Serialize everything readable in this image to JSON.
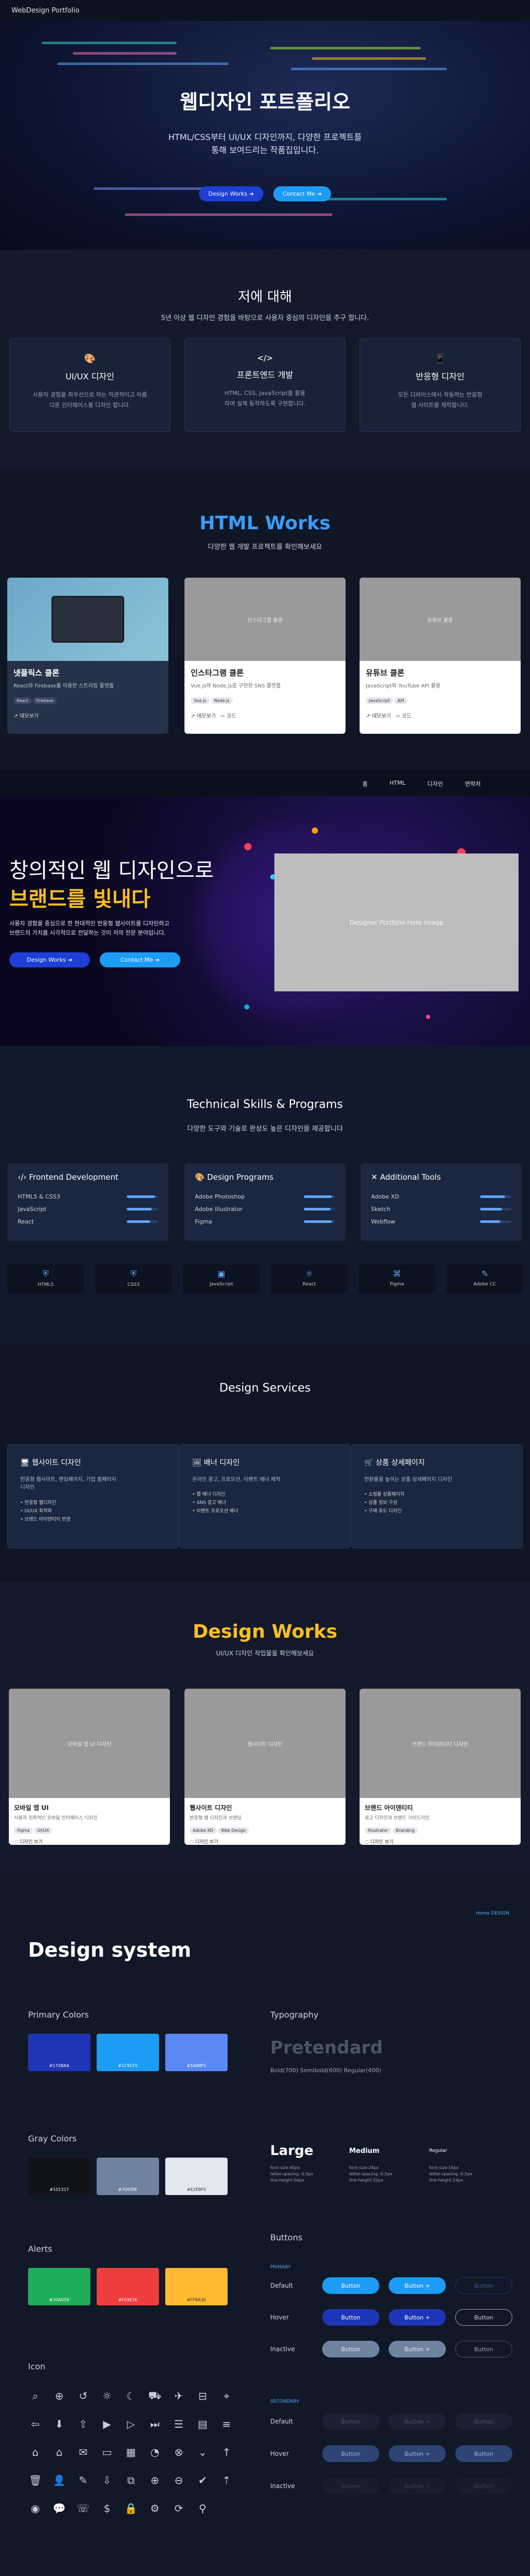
{
  "header": {
    "title": "WebDesign Portfolio"
  },
  "hero": {
    "title": "웹디자인 포트폴리오",
    "subtitle1": "HTML/CSS부터 UI/UX 디자인까지, 다양한 프로젝트를",
    "subtitle2": "통해 보여드리는 작품집입니다.",
    "btn1": "Design Works ➜",
    "btn2": "Contact Me ➜"
  },
  "about": {
    "title": "저에 대해",
    "desc": "5년 이상 웹 디자인 경험을 바탕으로 사용자 중심의 디자인을 추구 합니다.",
    "cards": [
      {
        "icon": "palette",
        "title": "UI/UX 디자인",
        "d1": "사용자 경험을 최우선으로 하는 직관적이고 아름",
        "d2": "다운 인터페이스를 디자인 합니다."
      },
      {
        "icon": "code",
        "title": "프론트엔드 개발",
        "d1": "HTML, CSS, JavaScript를 활용",
        "d2": "하여 실제 동작하도록 구현합니다."
      },
      {
        "icon": "mobile",
        "title": "반응형 디자인",
        "d1": "모든 디바이스에서 작동하는 반응형",
        "d2": "웹 사이트를 제작합니다."
      }
    ]
  },
  "works": {
    "title": "HTML Works",
    "desc": "다양한 웹 개발 프로젝트를 확인해보세요",
    "cards": [
      {
        "img": "",
        "title": "넷플릭스 클론",
        "desc": "React와 Firebase를 이용한 스트리밍 플랫폼",
        "tags": [
          "React",
          "Firebase"
        ],
        "link": "데모보기",
        "link2": ""
      },
      {
        "img": "인스타그램 클론",
        "title": "인스타그램 클론",
        "desc": "Vue.js와 Node.js로 구현한 SNS 플랫폼",
        "tags": [
          "Vue.js",
          "Node.js"
        ],
        "link": "데모보기",
        "link2": "코드"
      },
      {
        "img": "유튜브 클론",
        "title": "유튜브 클론",
        "desc": "JavaScript와 YouTube API 활용",
        "tags": [
          "JavaScript",
          "API"
        ],
        "link": "데모보기",
        "link2": "코드"
      }
    ]
  },
  "nav2": {
    "items": [
      "홈",
      "HTML",
      "디자인",
      "연락처"
    ]
  },
  "hero2": {
    "line1": "창의적인 웹 디자인으로",
    "line2": "브랜드를 빛내다",
    "d1": "사용자 경험을 중심으로 한 현대적인 반응형 웹사이트를 디자인하고",
    "d2": "브랜드의 가치를 시각적으로 전달하는 것이 저의 전문 분야입니다.",
    "btn1": "Design Works ➜",
    "btn2": "Contact Me ➜",
    "placeholder": "Designer Portfolio Hero Image"
  },
  "skills": {
    "title": "Technical Skills & Programs",
    "desc": "다양한 도구와 기술로 완성도 높은 디자인을 제공합니다",
    "boxes": [
      {
        "title": "Frontend Development",
        "items": [
          {
            "name": "HTML5 & CSS3",
            "level": 0.9
          },
          {
            "name": "JavaScript",
            "level": 0.8
          },
          {
            "name": "React",
            "level": 0.75
          }
        ]
      },
      {
        "title": "Design Programs",
        "items": [
          {
            "name": "Adobe Photoshop",
            "level": 0.9
          },
          {
            "name": "Adobe Illustrator",
            "level": 0.85
          },
          {
            "name": "Figma",
            "level": 0.9
          }
        ]
      },
      {
        "title": "Additional Tools",
        "items": [
          {
            "name": "Adobe XD",
            "level": 0.8
          },
          {
            "name": "Sketch",
            "level": 0.7
          },
          {
            "name": "Webflow",
            "level": 0.65
          }
        ]
      }
    ],
    "tools": [
      "HTML5",
      "CSS3",
      "JavaScript",
      "React",
      "Figma",
      "Adobe CC"
    ]
  },
  "services": {
    "title": "Design Services",
    "boxes": [
      {
        "title": "웹사이트 디자인",
        "d1": "반응형 웹사이트, 랜딩페이지, 기업 홈페이지",
        "d2": "디자인",
        "items": [
          "• 반응형 웹디자인",
          "• UI/UX 최적화",
          "• 브랜드 아이덴티티 반영"
        ]
      },
      {
        "title": "배너 디자인",
        "d1": "온라인 광고, 프로모션, 이벤트 배너 제작",
        "d2": "",
        "items": [
          "• 웹 배너 디자인",
          "• SNS 광고 배너",
          "• 이벤트 프로모션 배너"
        ]
      },
      {
        "title": "상품 상세페이지",
        "d1": "전환율을 높이는 상품 상세페이지 디자인",
        "d2": "",
        "items": [
          "• 쇼핑몰 상품페이지",
          "• 상품 정보 구성",
          "• 구매 유도 디자인"
        ]
      }
    ]
  },
  "dworks": {
    "title": "Design Works",
    "desc": "UI/UX 디자인 작업물을 확인해보세요",
    "cards": [
      {
        "img": "모바일 앱 UI 디자인",
        "title": "모바일 앱 UI",
        "desc": "사용자 친화적인 모바일 인터페이스 디자인",
        "tags": [
          "Figma",
          "UI/UX"
        ],
        "link": "디자인 보기"
      },
      {
        "img": "웹사이트 디자인",
        "title": "웹사이트 디자인",
        "desc": "반응형 웹 디자인과 브랜딩",
        "tags": [
          "Adobe XD",
          "Web Design"
        ],
        "link": "디자인 보기"
      },
      {
        "img": "브랜드 아이덴티티 디자인",
        "title": "브랜드 아이덴티티",
        "desc": "로고 디자인과 브랜드 가이드라인",
        "tags": [
          "Illustrator",
          "Branding"
        ],
        "link": "디자인 보기"
      }
    ]
  },
  "dsys": {
    "tag": "Home DESIGN",
    "title": "Design system",
    "primary": {
      "label": "Primary Colors",
      "colors": [
        {
          "hex": "#172BAA",
          "c": "#1f35b8"
        },
        {
          "hex": "#1C9CF5",
          "c": "#1c9cf5"
        },
        {
          "hex": "#5A88F5",
          "c": "#5a88f5"
        }
      ]
    },
    "gray": {
      "label": "Gray Colors",
      "colors": [
        {
          "hex": "#101317",
          "c": "#101317"
        },
        {
          "hex": "#70839E",
          "c": "#70839e"
        },
        {
          "hex": "#E2E8F0",
          "c": "#e2e8f0"
        }
      ]
    },
    "alerts": {
      "label": "Alerts",
      "colors": [
        {
          "hex": "#20AD59",
          "c": "#20ad59"
        },
        {
          "hex": "#F03E3E",
          "c": "#f03e3e"
        },
        {
          "hex": "#FFBA30",
          "c": "#ffba30"
        }
      ]
    },
    "icon_label": "Icon",
    "typo": {
      "label": "Typography",
      "font": "Pretendard",
      "weights": "Bold(700)  Semibold(600) Regular(400)",
      "large": "Large",
      "medium": "Medium",
      "regular": "Regular",
      "l1": "font-size:40px",
      "l2": "letter-spacing:-0.5px",
      "l3": "line-height:56px",
      "m1": "font-size:24px",
      "m2": "letter-spacing:-0.5px",
      "m3": "line-height:32px",
      "r1": "font-size:16px",
      "r2": "letter-spacing:-0.5px",
      "r3": "line-height:24px"
    },
    "buttons": {
      "label": "Buttons",
      "primary": "PRIMARY",
      "secondary": "SECONDARY",
      "default": "Default",
      "hover": "Hover",
      "inactive": "Inactive",
      "b": "Button",
      "ba": "Button +"
    }
  }
}
